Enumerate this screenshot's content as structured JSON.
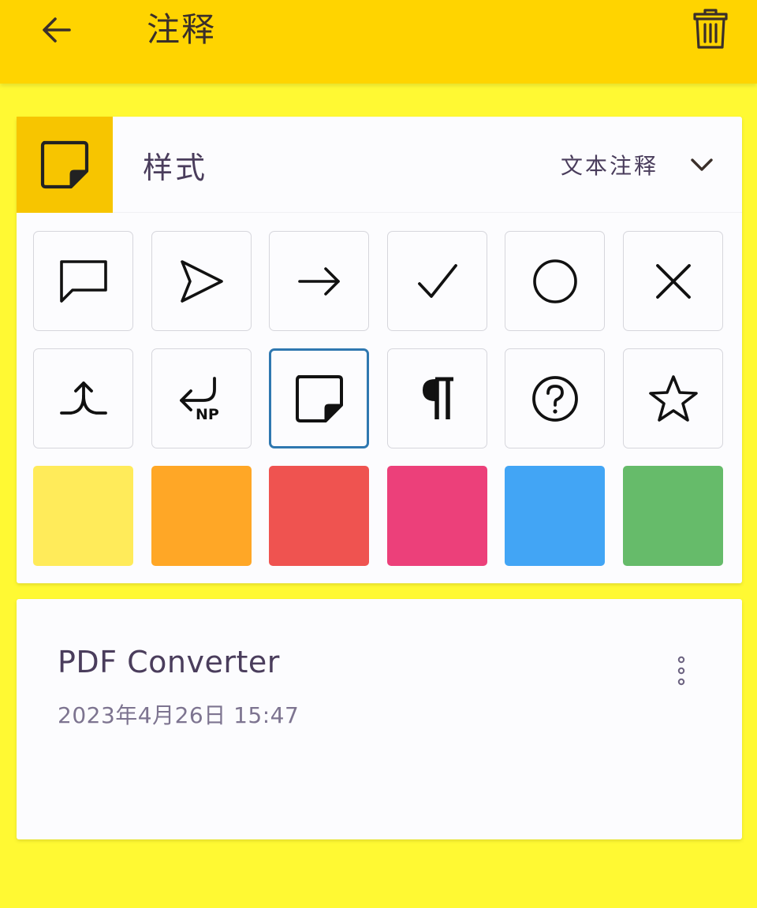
{
  "appbar": {
    "title": "注释",
    "back_icon": "arrow-left-icon",
    "delete_icon": "trash-icon"
  },
  "style_panel": {
    "label": "样式",
    "selected_icon": "sticky-note-icon",
    "type_select": {
      "value": "文本注释",
      "icon": "chevron-down-icon"
    },
    "icons": [
      {
        "name": "speech-bubble-icon"
      },
      {
        "name": "paper-plane-icon"
      },
      {
        "name": "arrow-right-icon"
      },
      {
        "name": "checkmark-icon"
      },
      {
        "name": "circle-icon"
      },
      {
        "name": "cross-icon"
      },
      {
        "name": "insert-caret-icon"
      },
      {
        "name": "new-paragraph-icon",
        "text": "NP"
      },
      {
        "name": "sticky-note-icon",
        "selected": true
      },
      {
        "name": "pilcrow-icon"
      },
      {
        "name": "help-circle-icon"
      },
      {
        "name": "star-icon"
      }
    ],
    "colors": [
      "#FFEB5A",
      "#FFA726",
      "#EF5350",
      "#EC407A",
      "#42A5F5",
      "#66BB6A"
    ],
    "accent": "#2F78B0",
    "selected_bg": "#F7C500"
  },
  "item": {
    "name": "PDF Converter",
    "date": "2023年4月26日 15:47",
    "more_icon": "more-vertical-icon"
  },
  "colors": {
    "appbar_bg": "#FFD400",
    "page_bg": "#FFF933",
    "text": "#4A3D5C"
  }
}
